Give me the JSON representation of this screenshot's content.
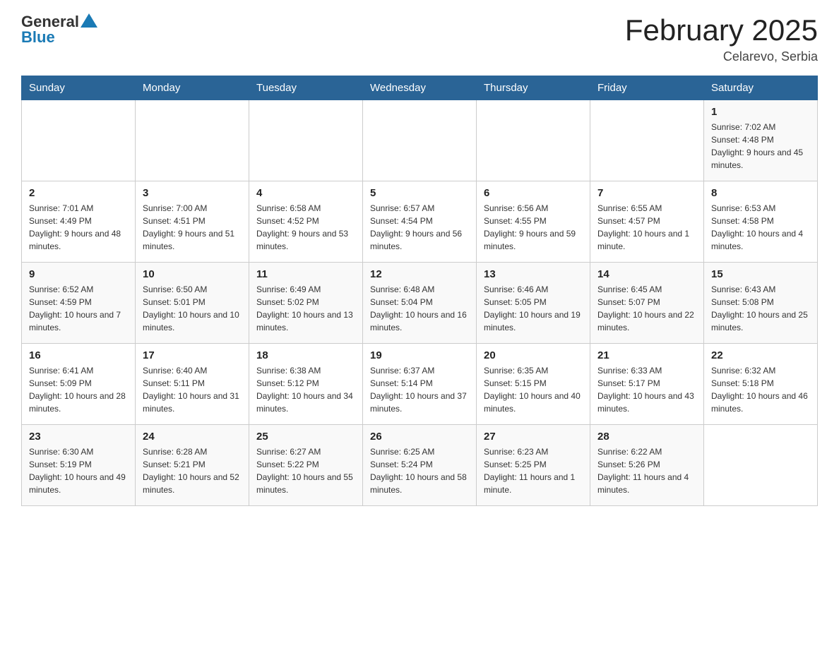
{
  "header": {
    "logo": {
      "general": "General",
      "blue": "Blue"
    },
    "title": "February 2025",
    "subtitle": "Celarevo, Serbia"
  },
  "weekdays": [
    "Sunday",
    "Monday",
    "Tuesday",
    "Wednesday",
    "Thursday",
    "Friday",
    "Saturday"
  ],
  "weeks": [
    [
      null,
      null,
      null,
      null,
      null,
      null,
      {
        "day": "1",
        "sunrise": "Sunrise: 7:02 AM",
        "sunset": "Sunset: 4:48 PM",
        "daylight": "Daylight: 9 hours and 45 minutes."
      }
    ],
    [
      {
        "day": "2",
        "sunrise": "Sunrise: 7:01 AM",
        "sunset": "Sunset: 4:49 PM",
        "daylight": "Daylight: 9 hours and 48 minutes."
      },
      {
        "day": "3",
        "sunrise": "Sunrise: 7:00 AM",
        "sunset": "Sunset: 4:51 PM",
        "daylight": "Daylight: 9 hours and 51 minutes."
      },
      {
        "day": "4",
        "sunrise": "Sunrise: 6:58 AM",
        "sunset": "Sunset: 4:52 PM",
        "daylight": "Daylight: 9 hours and 53 minutes."
      },
      {
        "day": "5",
        "sunrise": "Sunrise: 6:57 AM",
        "sunset": "Sunset: 4:54 PM",
        "daylight": "Daylight: 9 hours and 56 minutes."
      },
      {
        "day": "6",
        "sunrise": "Sunrise: 6:56 AM",
        "sunset": "Sunset: 4:55 PM",
        "daylight": "Daylight: 9 hours and 59 minutes."
      },
      {
        "day": "7",
        "sunrise": "Sunrise: 6:55 AM",
        "sunset": "Sunset: 4:57 PM",
        "daylight": "Daylight: 10 hours and 1 minute."
      },
      {
        "day": "8",
        "sunrise": "Sunrise: 6:53 AM",
        "sunset": "Sunset: 4:58 PM",
        "daylight": "Daylight: 10 hours and 4 minutes."
      }
    ],
    [
      {
        "day": "9",
        "sunrise": "Sunrise: 6:52 AM",
        "sunset": "Sunset: 4:59 PM",
        "daylight": "Daylight: 10 hours and 7 minutes."
      },
      {
        "day": "10",
        "sunrise": "Sunrise: 6:50 AM",
        "sunset": "Sunset: 5:01 PM",
        "daylight": "Daylight: 10 hours and 10 minutes."
      },
      {
        "day": "11",
        "sunrise": "Sunrise: 6:49 AM",
        "sunset": "Sunset: 5:02 PM",
        "daylight": "Daylight: 10 hours and 13 minutes."
      },
      {
        "day": "12",
        "sunrise": "Sunrise: 6:48 AM",
        "sunset": "Sunset: 5:04 PM",
        "daylight": "Daylight: 10 hours and 16 minutes."
      },
      {
        "day": "13",
        "sunrise": "Sunrise: 6:46 AM",
        "sunset": "Sunset: 5:05 PM",
        "daylight": "Daylight: 10 hours and 19 minutes."
      },
      {
        "day": "14",
        "sunrise": "Sunrise: 6:45 AM",
        "sunset": "Sunset: 5:07 PM",
        "daylight": "Daylight: 10 hours and 22 minutes."
      },
      {
        "day": "15",
        "sunrise": "Sunrise: 6:43 AM",
        "sunset": "Sunset: 5:08 PM",
        "daylight": "Daylight: 10 hours and 25 minutes."
      }
    ],
    [
      {
        "day": "16",
        "sunrise": "Sunrise: 6:41 AM",
        "sunset": "Sunset: 5:09 PM",
        "daylight": "Daylight: 10 hours and 28 minutes."
      },
      {
        "day": "17",
        "sunrise": "Sunrise: 6:40 AM",
        "sunset": "Sunset: 5:11 PM",
        "daylight": "Daylight: 10 hours and 31 minutes."
      },
      {
        "day": "18",
        "sunrise": "Sunrise: 6:38 AM",
        "sunset": "Sunset: 5:12 PM",
        "daylight": "Daylight: 10 hours and 34 minutes."
      },
      {
        "day": "19",
        "sunrise": "Sunrise: 6:37 AM",
        "sunset": "Sunset: 5:14 PM",
        "daylight": "Daylight: 10 hours and 37 minutes."
      },
      {
        "day": "20",
        "sunrise": "Sunrise: 6:35 AM",
        "sunset": "Sunset: 5:15 PM",
        "daylight": "Daylight: 10 hours and 40 minutes."
      },
      {
        "day": "21",
        "sunrise": "Sunrise: 6:33 AM",
        "sunset": "Sunset: 5:17 PM",
        "daylight": "Daylight: 10 hours and 43 minutes."
      },
      {
        "day": "22",
        "sunrise": "Sunrise: 6:32 AM",
        "sunset": "Sunset: 5:18 PM",
        "daylight": "Daylight: 10 hours and 46 minutes."
      }
    ],
    [
      {
        "day": "23",
        "sunrise": "Sunrise: 6:30 AM",
        "sunset": "Sunset: 5:19 PM",
        "daylight": "Daylight: 10 hours and 49 minutes."
      },
      {
        "day": "24",
        "sunrise": "Sunrise: 6:28 AM",
        "sunset": "Sunset: 5:21 PM",
        "daylight": "Daylight: 10 hours and 52 minutes."
      },
      {
        "day": "25",
        "sunrise": "Sunrise: 6:27 AM",
        "sunset": "Sunset: 5:22 PM",
        "daylight": "Daylight: 10 hours and 55 minutes."
      },
      {
        "day": "26",
        "sunrise": "Sunrise: 6:25 AM",
        "sunset": "Sunset: 5:24 PM",
        "daylight": "Daylight: 10 hours and 58 minutes."
      },
      {
        "day": "27",
        "sunrise": "Sunrise: 6:23 AM",
        "sunset": "Sunset: 5:25 PM",
        "daylight": "Daylight: 11 hours and 1 minute."
      },
      {
        "day": "28",
        "sunrise": "Sunrise: 6:22 AM",
        "sunset": "Sunset: 5:26 PM",
        "daylight": "Daylight: 11 hours and 4 minutes."
      },
      null
    ]
  ]
}
